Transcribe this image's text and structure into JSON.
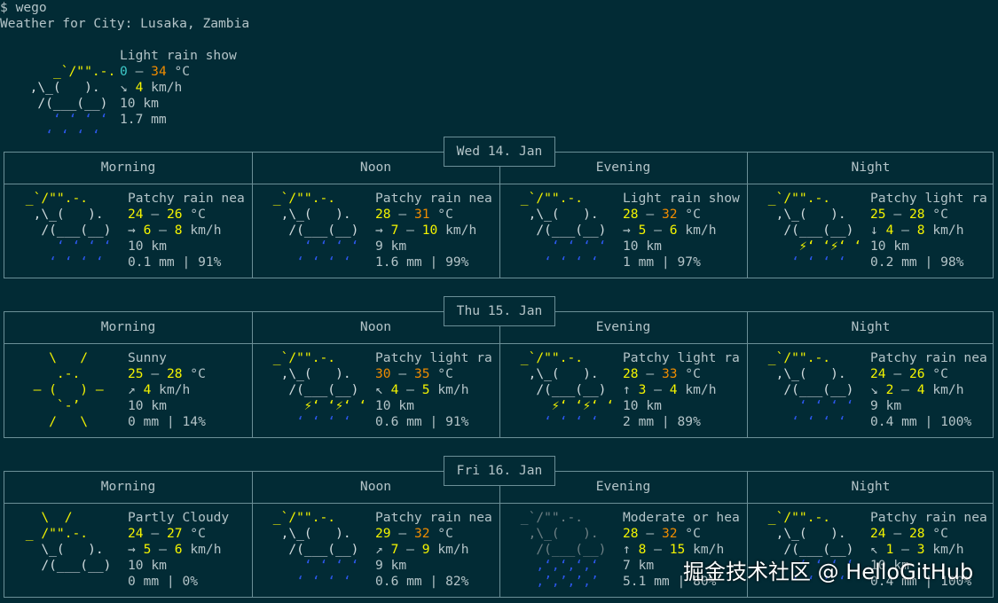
{
  "prompt": "$ wego",
  "title": "Weather for City: Lusaka, Zambia",
  "current": {
    "art": [
      " _`/\"\".-.",
      "  ,\\_(   ).",
      "   /(___(__)",
      "     ‘ ‘ ‘ ‘",
      "    ‘ ‘ ‘ ‘"
    ],
    "desc": "Light rain show",
    "temp_lo": "0",
    "temp_sep": " – ",
    "temp_hi": "34",
    "temp_unit": " °C",
    "wind_arrow": "↘",
    "wind": "4",
    "wind_unit": " km/h",
    "visibility": "10 km",
    "precip": "1.7 mm"
  },
  "period_labels": [
    "Morning",
    "Noon",
    "Evening",
    "Night"
  ],
  "days": [
    {
      "date": "Wed 14. Jan",
      "periods": [
        {
          "desc": "Patchy rain nea",
          "lo": "24",
          "hi": "26",
          "wind_arrow": "→",
          "wind_lo": "6",
          "wind_hi": "8",
          "vis": "10 km",
          "precip": "0.1 mm | 91%"
        },
        {
          "desc": "Patchy rain nea",
          "lo": "28",
          "hi": "31",
          "wind_arrow": "→",
          "wind_lo": "7",
          "wind_hi": "10",
          "vis": "9 km",
          "precip": "1.6 mm | 99%"
        },
        {
          "desc": "Light rain show",
          "lo": "28",
          "hi": "32",
          "wind_arrow": "→",
          "wind_lo": "5",
          "wind_hi": "6",
          "vis": "10 km",
          "precip": "1 mm | 97%"
        },
        {
          "desc": "Patchy light ra",
          "lo": "25",
          "hi": "28",
          "wind_arrow": "↓",
          "wind_lo": "4",
          "wind_hi": "8",
          "vis": "10 km",
          "precip": "0.2 mm | 98%"
        }
      ]
    },
    {
      "date": "Thu 15. Jan",
      "periods": [
        {
          "desc": "Sunny",
          "lo": "25",
          "hi": "28",
          "wind_arrow": "↗",
          "wind_lo": "4",
          "wind_hi": "",
          "vis": "10 km",
          "precip": "0 mm | 14%"
        },
        {
          "desc": "Patchy light ra",
          "lo": "30",
          "hi": "35",
          "wind_arrow": "↖",
          "wind_lo": "4",
          "wind_hi": "5",
          "vis": "10 km",
          "precip": "0.6 mm | 91%"
        },
        {
          "desc": "Patchy light ra",
          "lo": "28",
          "hi": "33",
          "wind_arrow": "↑",
          "wind_lo": "3",
          "wind_hi": "4",
          "vis": "10 km",
          "precip": "2 mm | 89%"
        },
        {
          "desc": "Patchy rain nea",
          "lo": "24",
          "hi": "26",
          "wind_arrow": "↘",
          "wind_lo": "2",
          "wind_hi": "4",
          "vis": "9 km",
          "precip": "0.4 mm | 100%"
        }
      ]
    },
    {
      "date": "Fri 16. Jan",
      "periods": [
        {
          "desc": "Partly Cloudy",
          "lo": "24",
          "hi": "27",
          "wind_arrow": "→",
          "wind_lo": "5",
          "wind_hi": "6",
          "vis": "10 km",
          "precip": "0 mm | 0%"
        },
        {
          "desc": "Patchy rain nea",
          "lo": "29",
          "hi": "32",
          "wind_arrow": "↗",
          "wind_lo": "7",
          "wind_hi": "9",
          "vis": "9 km",
          "precip": "0.6 mm | 82%"
        },
        {
          "desc": "Moderate or hea",
          "lo": "28",
          "hi": "32",
          "wind_arrow": "↑",
          "wind_lo": "8",
          "wind_hi": "15",
          "vis": "7 km",
          "precip": "5.1 mm | 80%"
        },
        {
          "desc": "Patchy rain nea",
          "lo": "24",
          "hi": "28",
          "wind_arrow": "↖",
          "wind_lo": "1",
          "wind_hi": "3",
          "vis": "10 km",
          "precip": "0.4 mm | 100%"
        }
      ]
    }
  ],
  "watermark": "掘金技术社区 @ HelloGitHub",
  "colors": {
    "background": "#022b35",
    "text": "#b4c4c8",
    "yellow": "#f4f400",
    "orange": "#f08c00",
    "rain": "#2d58f0",
    "border": "#6b8f97"
  }
}
